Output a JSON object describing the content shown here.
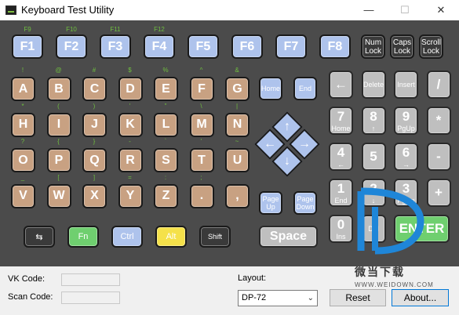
{
  "window": {
    "title": "Keyboard Test Utility",
    "minimize": "—",
    "maximize": "☐",
    "close": "✕"
  },
  "fkeys": [
    {
      "label": "F1",
      "sub": "F9"
    },
    {
      "label": "F2",
      "sub": "F10"
    },
    {
      "label": "F3",
      "sub": "F11"
    },
    {
      "label": "F4",
      "sub": "F12"
    },
    {
      "label": "F5",
      "sub": ""
    },
    {
      "label": "F6",
      "sub": ""
    },
    {
      "label": "F7",
      "sub": ""
    },
    {
      "label": "F8",
      "sub": ""
    }
  ],
  "locks": [
    "Num\nLock",
    "Caps\nLock",
    "Scroll\nLock"
  ],
  "letter_rows": [
    [
      {
        "k": "A",
        "s": "!"
      },
      {
        "k": "B",
        "s": "@"
      },
      {
        "k": "C",
        "s": "#"
      },
      {
        "k": "D",
        "s": "$"
      },
      {
        "k": "E",
        "s": "%"
      },
      {
        "k": "F",
        "s": "^"
      },
      {
        "k": "G",
        "s": "&"
      }
    ],
    [
      {
        "k": "H",
        "s": "*"
      },
      {
        "k": "I",
        "s": "("
      },
      {
        "k": "J",
        "s": ")"
      },
      {
        "k": "K",
        "s": "'"
      },
      {
        "k": "L",
        "s": "\""
      },
      {
        "k": "M",
        "s": "\\"
      },
      {
        "k": "N",
        "s": "|"
      }
    ],
    [
      {
        "k": "O",
        "s": "?"
      },
      {
        "k": "P",
        "s": "{"
      },
      {
        "k": "Q",
        "s": "}"
      },
      {
        "k": "R",
        "s": "-"
      },
      {
        "k": "S",
        "s": "`"
      },
      {
        "k": "T",
        "s": "'"
      },
      {
        "k": "U",
        "s": "~"
      }
    ],
    [
      {
        "k": "V",
        "s": "_"
      },
      {
        "k": "W",
        "s": "["
      },
      {
        "k": "X",
        "s": "]"
      },
      {
        "k": "Y",
        "s": "="
      },
      {
        "k": "Z",
        "s": ":"
      },
      {
        "k": ".",
        "s": ";"
      },
      {
        "k": ",",
        "s": ""
      }
    ]
  ],
  "modifiers": [
    {
      "label": "⇆",
      "color": "#3a3a3a"
    },
    {
      "label": "Fn",
      "color": "#6fcf6f"
    },
    {
      "label": "Ctrl",
      "color": "#aec3ec"
    },
    {
      "label": "Alt",
      "color": "#f5e14a"
    },
    {
      "label": "Shift",
      "color": "#3a3a3a"
    }
  ],
  "nav": {
    "home": "Home",
    "end": "End",
    "page_up": "Page\nUp",
    "page_down": "Page\nDown",
    "space": "Space"
  },
  "arrows": {
    "up": "↑",
    "down": "↓",
    "left": "←",
    "right": "→"
  },
  "numpad": [
    [
      {
        "big": "←",
        "sm": ""
      },
      {
        "big": "",
        "sm": "Delete"
      },
      {
        "big": "",
        "sm": "Insert"
      },
      {
        "big": "/",
        "sm": ""
      }
    ],
    [
      {
        "big": "7",
        "sm": "Home"
      },
      {
        "big": "8",
        "sm": "↑"
      },
      {
        "big": "9",
        "sm": "PgUp"
      },
      {
        "big": "*",
        "sm": ""
      }
    ],
    [
      {
        "big": "4",
        "sm": "←"
      },
      {
        "big": "5",
        "sm": ""
      },
      {
        "big": "6",
        "sm": "→"
      },
      {
        "big": "-",
        "sm": ""
      }
    ],
    [
      {
        "big": "1",
        "sm": "End"
      },
      {
        "big": "2",
        "sm": "↓"
      },
      {
        "big": "3",
        "sm": "PgDn"
      },
      {
        "big": "+",
        "sm": ""
      }
    ],
    [
      {
        "big": "0",
        "sm": "Ins"
      },
      {
        "big": "",
        "sm": "Del"
      },
      {
        "big": "ENTER",
        "sm": ""
      }
    ]
  ],
  "bottom": {
    "vk_label": "VK Code:",
    "scan_label": "Scan Code:",
    "layout_label": "Layout:",
    "layout_value": "DP-72",
    "reset": "Reset",
    "about": "About..."
  },
  "watermark": {
    "text": "微当下载",
    "url": "WWW.WEIDOWN.COM"
  },
  "colors": {
    "fkey": "#aec3ec",
    "letter": "#c8a182",
    "num": "#bfbfbf",
    "panel": "#4b4b4b",
    "sublabel": "#6fbf3f"
  }
}
